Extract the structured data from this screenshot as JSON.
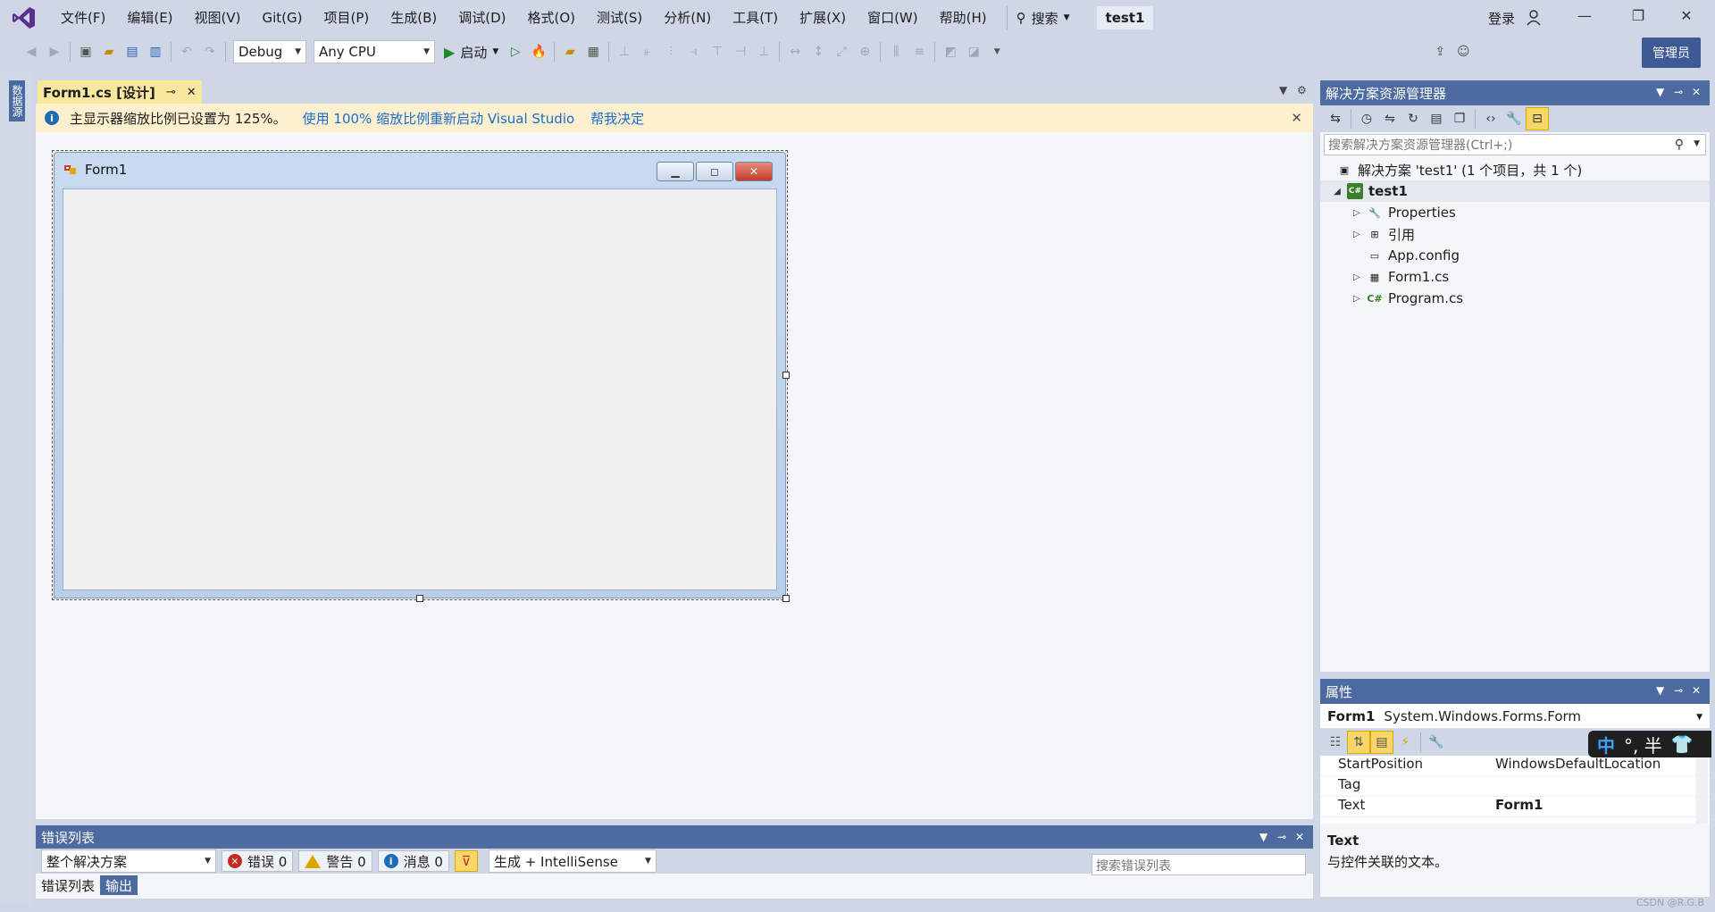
{
  "titlebar": {
    "menu": [
      "文件(F)",
      "编辑(E)",
      "视图(V)",
      "Git(G)",
      "项目(P)",
      "生成(B)",
      "调试(D)",
      "格式(O)",
      "测试(S)",
      "分析(N)",
      "工具(T)",
      "扩展(X)",
      "窗口(W)",
      "帮助(H)"
    ],
    "search_label": "搜索",
    "solution_name": "test1",
    "login_label": "登录",
    "admin_label": "管理员"
  },
  "toolbar": {
    "config": "Debug",
    "platform": "Any CPU",
    "start_label": "启动"
  },
  "left_strip": {
    "tab_label": "数据源"
  },
  "editor": {
    "tab_label": "Form1.cs [设计]",
    "info_text": "主显示器缩放比例已设置为 125%。",
    "info_link1": "使用 100% 缩放比例重新启动 Visual Studio",
    "info_link2": "帮我决定",
    "form_caption": "Form1"
  },
  "solution_explorer": {
    "title": "解决方案资源管理器",
    "search_placeholder": "搜索解决方案资源管理器(Ctrl+;)",
    "solution_line": "解决方案 'test1' (1 个项目，共 1 个)",
    "project": "test1",
    "items": [
      "Properties",
      "引用",
      "App.config",
      "Form1.cs",
      "Program.cs"
    ]
  },
  "properties": {
    "title": "属性",
    "object_name": "Form1",
    "object_type": "System.Windows.Forms.Form",
    "rows": [
      {
        "name": "StartPosition",
        "value": "WindowsDefaultLocation"
      },
      {
        "name": "Tag",
        "value": ""
      },
      {
        "name": "Text",
        "value": "Form1"
      }
    ],
    "desc_title": "Text",
    "desc_text": "与控件关联的文本。"
  },
  "ime": {
    "lang": "中",
    "symbols": "°, 半"
  },
  "error_list": {
    "title": "错误列表",
    "scope": "整个解决方案",
    "errors_label": "错误 0",
    "warnings_label": "警告 0",
    "messages_label": "消息 0",
    "build_filter": "生成 + IntelliSense",
    "search_placeholder": "搜索错误列表"
  },
  "bottom_tabs": [
    "错误列表",
    "输出"
  ],
  "watermark": "CSDN @R.G.B"
}
